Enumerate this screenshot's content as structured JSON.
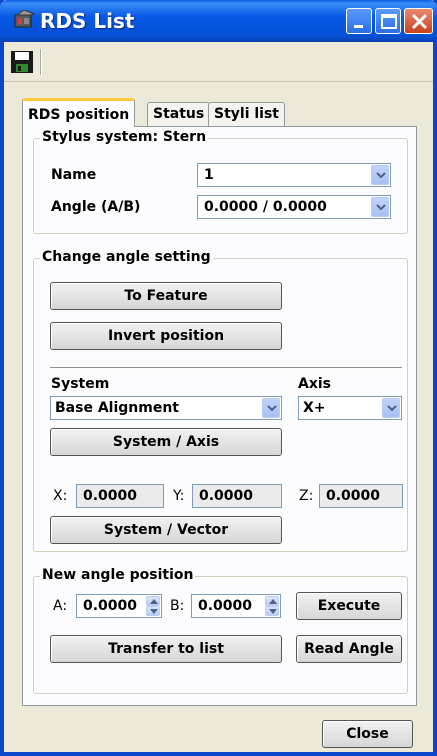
{
  "window": {
    "title": "RDS List"
  },
  "tabs": [
    {
      "label": "RDS position"
    },
    {
      "label": "Status"
    },
    {
      "label": "Styli list"
    }
  ],
  "stylus_group": {
    "legend": "Stylus system: Stern",
    "name_label": "Name",
    "name_value": "1",
    "angle_label": "Angle (A/B)",
    "angle_value": "0.0000 / 0.0000"
  },
  "change_group": {
    "legend": "Change angle setting",
    "to_feature": "To Feature",
    "invert_position": "Invert position",
    "system_label": "System",
    "axis_label": "Axis",
    "system_value": "Base Alignment",
    "axis_value": "X+",
    "system_axis_button": "System / Axis",
    "x_label": "X:",
    "x_value": "0.0000",
    "y_label": "Y:",
    "y_value": "0.0000",
    "z_label": "Z:",
    "z_value": "0.0000",
    "system_vector_button": "System / Vector"
  },
  "new_angle_group": {
    "legend": "New angle position",
    "a_label": "A:",
    "a_value": "0.0000",
    "b_label": "B:",
    "b_value": "0.0000",
    "execute": "Execute",
    "transfer": "Transfer to list",
    "read_angle": "Read Angle"
  },
  "footer": {
    "close": "Close"
  },
  "colors": {
    "titlebar": "#0758e6",
    "tab_highlight": "#ffc83c",
    "close_button": "#c9401e"
  },
  "icons": [
    "app-icon",
    "save-icon",
    "minimize-icon",
    "maximize-icon",
    "close-icon",
    "chevron-down-icon",
    "spin-up-icon",
    "spin-down-icon"
  ]
}
